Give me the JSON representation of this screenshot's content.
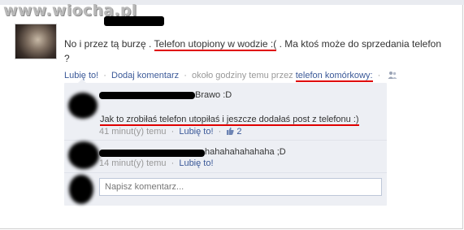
{
  "watermark": "www.wiocha.pl",
  "post": {
    "text_before": "No i przez tą burzę . ",
    "text_highlight": "Telefon utopiony w wodzie :(",
    "text_after": " . Ma ktoś może do sprzedania telefon ?",
    "actions": {
      "like": "Lubię to!",
      "comment": "Dodaj komentarz",
      "time": "około godziny temu przez",
      "via": "telefon komórkowy",
      "via_suffix": ":"
    }
  },
  "comments": [
    {
      "text": "Brawo :D",
      "text2": "Jak to zrobiłaś telefon utopiłaś i jeszcze dodałaś post z telefonu :)",
      "time": "41 minut(y) temu",
      "like": "Lubię to!",
      "likes_count": "2"
    },
    {
      "text": "hahahahahahaha ;D",
      "time": "14 minut(y) temu",
      "like": "Lubię to!"
    }
  ],
  "comment_input": {
    "placeholder": "Napisz komentarz..."
  },
  "colors": {
    "link": "#3b5998",
    "highlight": "#e00000",
    "comments_bg": "#edeff4"
  }
}
